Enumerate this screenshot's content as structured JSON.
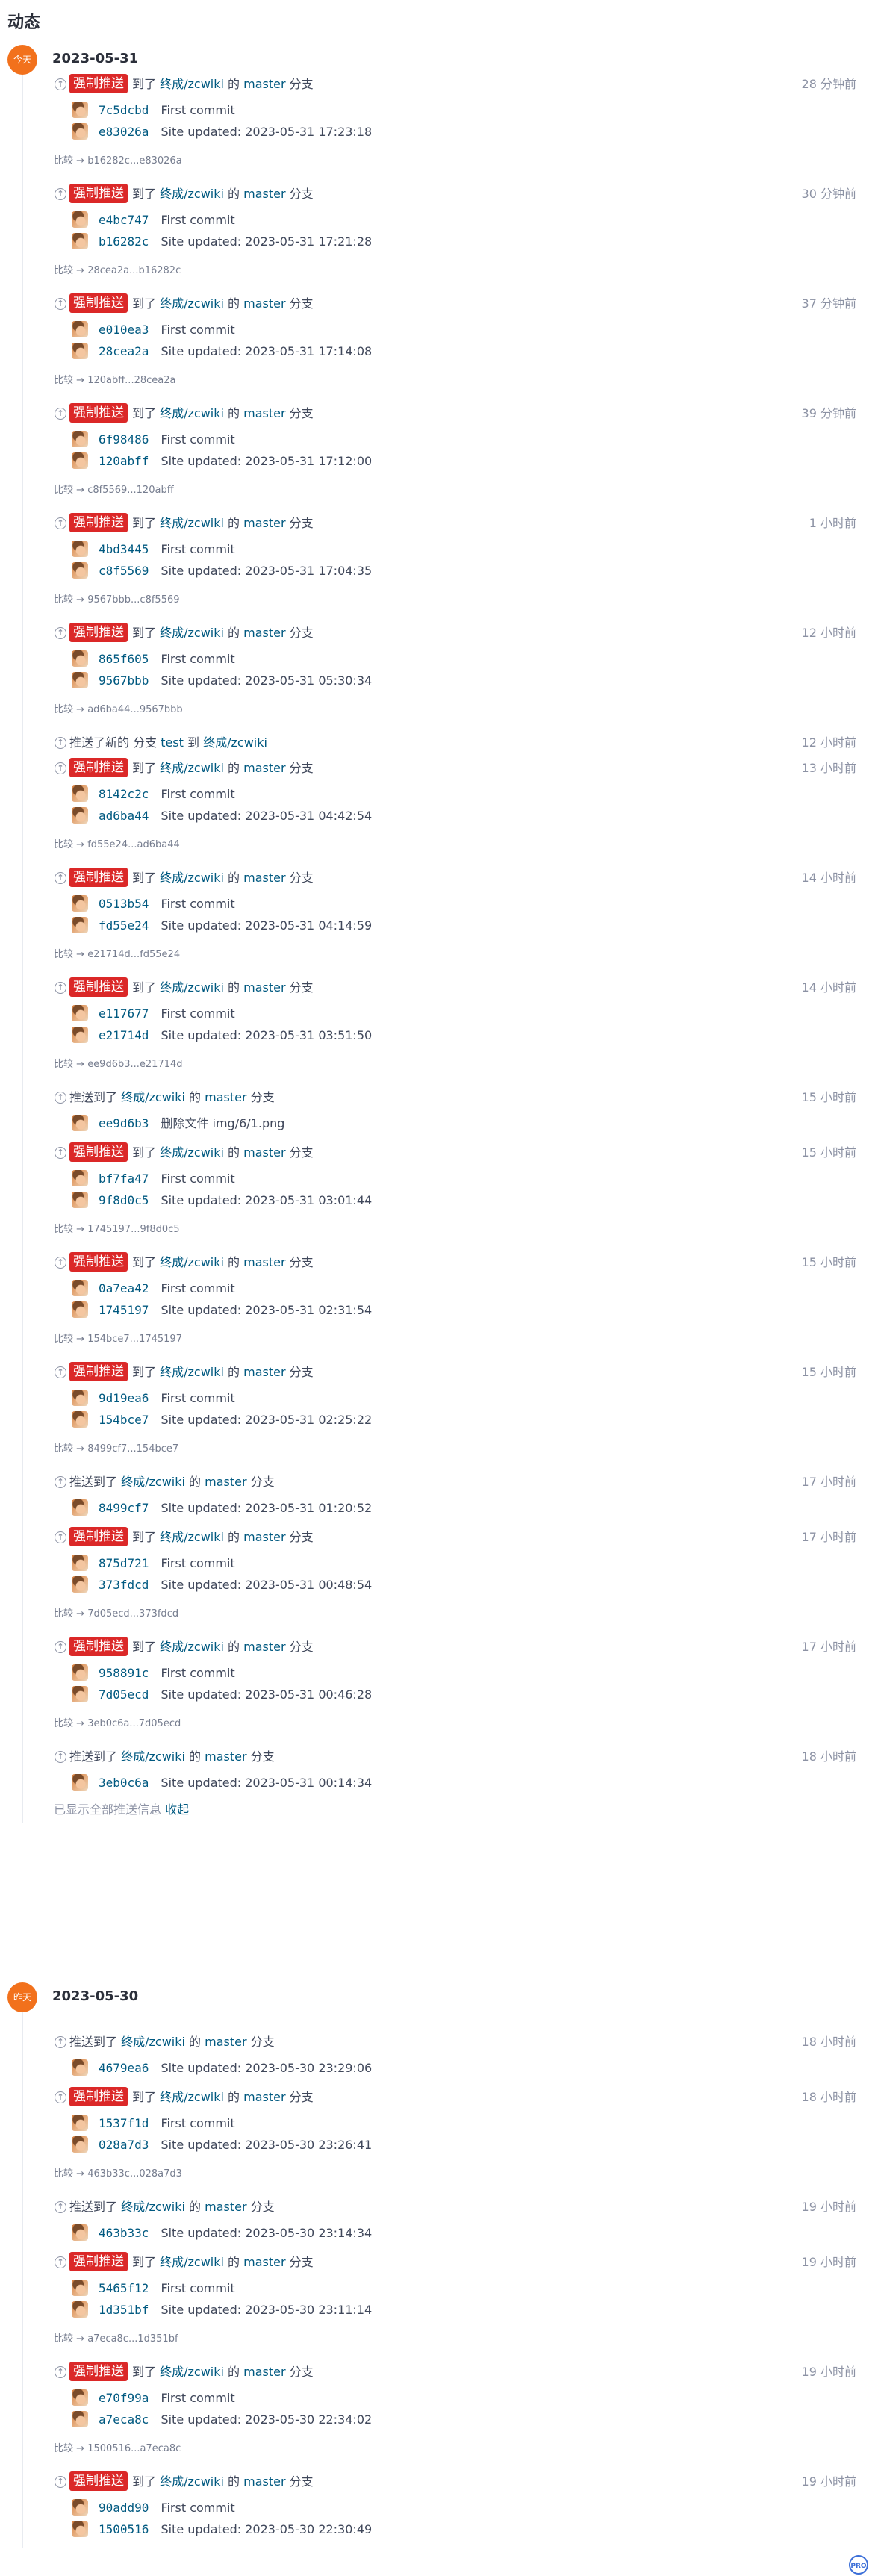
{
  "page": {
    "title": "动态"
  },
  "labels": {
    "force_push": "强制推送",
    "to_pre": "到了",
    "push_pre": "推送到了",
    "of": "的",
    "branch_suffix": "分支",
    "compare": "比较",
    "new_branch_pre": "推送了新的 分支",
    "new_branch_to": "到",
    "shown_all": "已显示全部推送信息",
    "collapse": "收起"
  },
  "repo": "终成/zcwiki",
  "colors": {
    "badge_force": "#db2828",
    "day_badge": "#f2711c",
    "link": "#005980",
    "muted": "#8c92a4"
  },
  "days": [
    {
      "badge": "今天",
      "date": "2023-05-31",
      "events": [
        {
          "kind": "force",
          "branch": "master",
          "time": "28 分钟前",
          "commits": [
            [
              "7c5dcbd",
              "First commit"
            ],
            [
              "e83026a",
              "Site updated: 2023-05-31 17:23:18"
            ]
          ],
          "compare": "b16282c...e83026a"
        },
        {
          "kind": "force",
          "branch": "master",
          "time": "30 分钟前",
          "commits": [
            [
              "e4bc747",
              "First commit"
            ],
            [
              "b16282c",
              "Site updated: 2023-05-31 17:21:28"
            ]
          ],
          "compare": "28cea2a...b16282c"
        },
        {
          "kind": "force",
          "branch": "master",
          "time": "37 分钟前",
          "commits": [
            [
              "e010ea3",
              "First commit"
            ],
            [
              "28cea2a",
              "Site updated: 2023-05-31 17:14:08"
            ]
          ],
          "compare": "120abff...28cea2a"
        },
        {
          "kind": "force",
          "branch": "master",
          "time": "39 分钟前",
          "commits": [
            [
              "6f98486",
              "First commit"
            ],
            [
              "120abff",
              "Site updated: 2023-05-31 17:12:00"
            ]
          ],
          "compare": "c8f5569...120abff"
        },
        {
          "kind": "force",
          "branch": "master",
          "time": "1 小时前",
          "commits": [
            [
              "4bd3445",
              "First commit"
            ],
            [
              "c8f5569",
              "Site updated: 2023-05-31 17:04:35"
            ]
          ],
          "compare": "9567bbb...c8f5569"
        },
        {
          "kind": "force",
          "branch": "master",
          "time": "12 小时前",
          "commits": [
            [
              "865f605",
              "First commit"
            ],
            [
              "9567bbb",
              "Site updated: 2023-05-31 05:30:34"
            ]
          ],
          "compare": "ad6ba44...9567bbb"
        },
        {
          "kind": "newbranch",
          "branch": "test",
          "time": "12 小时前",
          "commits": [],
          "compare": null
        },
        {
          "kind": "force",
          "branch": "master",
          "time": "13 小时前",
          "commits": [
            [
              "8142c2c",
              "First commit"
            ],
            [
              "ad6ba44",
              "Site updated: 2023-05-31 04:42:54"
            ]
          ],
          "compare": "fd55e24...ad6ba44"
        },
        {
          "kind": "force",
          "branch": "master",
          "time": "14 小时前",
          "commits": [
            [
              "0513b54",
              "First commit"
            ],
            [
              "fd55e24",
              "Site updated: 2023-05-31 04:14:59"
            ]
          ],
          "compare": "e21714d...fd55e24"
        },
        {
          "kind": "force",
          "branch": "master",
          "time": "14 小时前",
          "commits": [
            [
              "e117677",
              "First commit"
            ],
            [
              "e21714d",
              "Site updated: 2023-05-31 03:51:50"
            ]
          ],
          "compare": "ee9d6b3...e21714d"
        },
        {
          "kind": "push",
          "branch": "master",
          "time": "15 小时前",
          "commits": [
            [
              "ee9d6b3",
              "删除文件 img/6/1.png"
            ]
          ],
          "compare": null
        },
        {
          "kind": "force",
          "branch": "master",
          "time": "15 小时前",
          "commits": [
            [
              "bf7fa47",
              "First commit"
            ],
            [
              "9f8d0c5",
              "Site updated: 2023-05-31 03:01:44"
            ]
          ],
          "compare": "1745197...9f8d0c5"
        },
        {
          "kind": "force",
          "branch": "master",
          "time": "15 小时前",
          "commits": [
            [
              "0a7ea42",
              "First commit"
            ],
            [
              "1745197",
              "Site updated: 2023-05-31 02:31:54"
            ]
          ],
          "compare": "154bce7...1745197"
        },
        {
          "kind": "force",
          "branch": "master",
          "time": "15 小时前",
          "commits": [
            [
              "9d19ea6",
              "First commit"
            ],
            [
              "154bce7",
              "Site updated: 2023-05-31 02:25:22"
            ]
          ],
          "compare": "8499cf7...154bce7"
        },
        {
          "kind": "push",
          "branch": "master",
          "time": "17 小时前",
          "commits": [
            [
              "8499cf7",
              "Site updated: 2023-05-31 01:20:52"
            ]
          ],
          "compare": null
        },
        {
          "kind": "force",
          "branch": "master",
          "time": "17 小时前",
          "commits": [
            [
              "875d721",
              "First commit"
            ],
            [
              "373fdcd",
              "Site updated: 2023-05-31 00:48:54"
            ]
          ],
          "compare": "7d05ecd...373fdcd"
        },
        {
          "kind": "force",
          "branch": "master",
          "time": "17 小时前",
          "commits": [
            [
              "958891c",
              "First commit"
            ],
            [
              "7d05ecd",
              "Site updated: 2023-05-31 00:46:28"
            ]
          ],
          "compare": "3eb0c6a...7d05ecd"
        },
        {
          "kind": "push",
          "branch": "master",
          "time": "18 小时前",
          "commits": [
            [
              "3eb0c6a",
              "Site updated: 2023-05-31 00:14:34"
            ]
          ],
          "compare": null
        }
      ],
      "footer": true
    },
    {
      "badge": "昨天",
      "date": "2023-05-30",
      "events": [
        {
          "kind": "push",
          "branch": "master",
          "time": "18 小时前",
          "commits": [
            [
              "4679ea6",
              "Site updated: 2023-05-30 23:29:06"
            ]
          ],
          "compare": null
        },
        {
          "kind": "force",
          "branch": "master",
          "time": "18 小时前",
          "commits": [
            [
              "1537f1d",
              "First commit"
            ],
            [
              "028a7d3",
              "Site updated: 2023-05-30 23:26:41"
            ]
          ],
          "compare": "463b33c...028a7d3"
        },
        {
          "kind": "push",
          "branch": "master",
          "time": "19 小时前",
          "commits": [
            [
              "463b33c",
              "Site updated: 2023-05-30 23:14:34"
            ]
          ],
          "compare": null
        },
        {
          "kind": "force",
          "branch": "master",
          "time": "19 小时前",
          "commits": [
            [
              "5465f12",
              "First commit"
            ],
            [
              "1d351bf",
              "Site updated: 2023-05-30 23:11:14"
            ]
          ],
          "compare": "a7eca8c...1d351bf"
        },
        {
          "kind": "force",
          "branch": "master",
          "time": "19 小时前",
          "commits": [
            [
              "e70f99a",
              "First commit"
            ],
            [
              "a7eca8c",
              "Site updated: 2023-05-30 22:34:02"
            ]
          ],
          "compare": "1500516...a7eca8c"
        },
        {
          "kind": "force",
          "branch": "master",
          "time": "19 小时前",
          "commits": [
            [
              "90add90",
              "First commit"
            ],
            [
              "1500516",
              "Site updated: 2023-05-30 22:30:49"
            ]
          ],
          "compare": null
        }
      ],
      "footer": false
    }
  ],
  "corner_icon_text": "PRO"
}
